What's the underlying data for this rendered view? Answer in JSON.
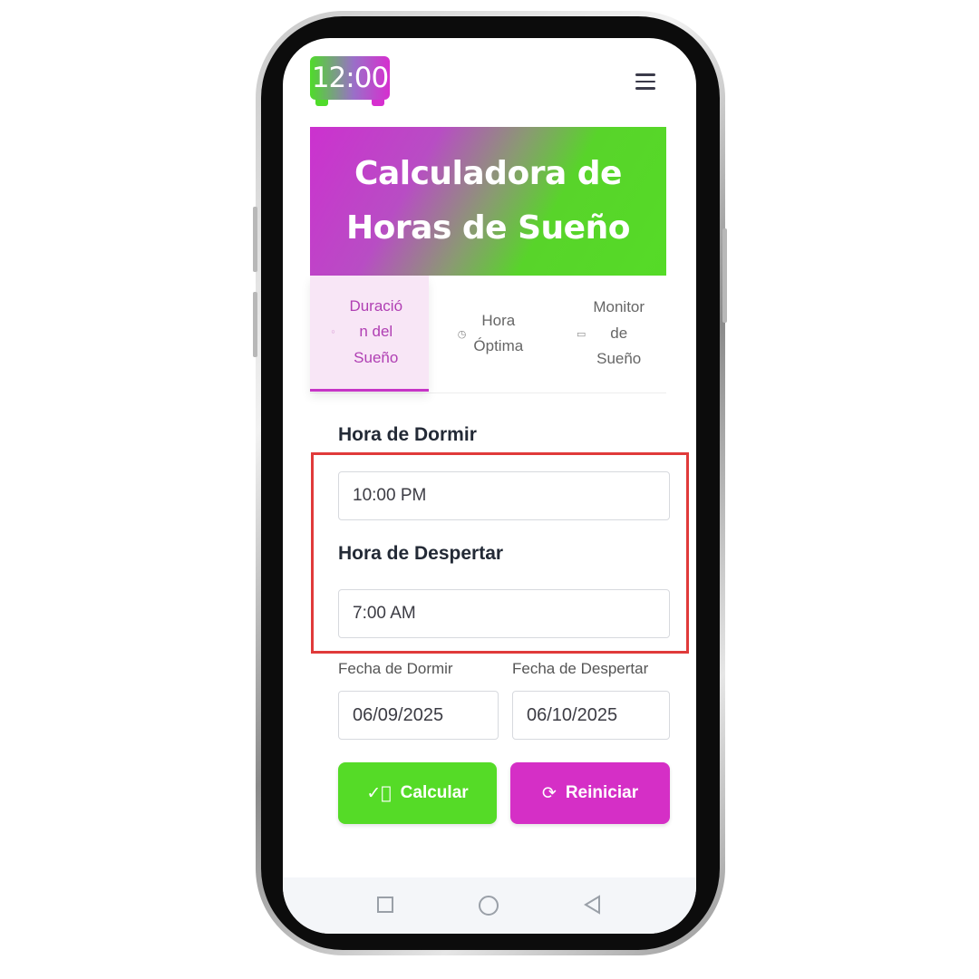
{
  "header": {
    "logo_text": "12:00",
    "menu_icon": "hamburger-menu-icon"
  },
  "banner": {
    "title": "Calculadora de Horas de Sueño"
  },
  "tabs": [
    {
      "label": "Duración del Sueño",
      "display": "Duració\nn del\nSueño",
      "icon": "moon-icon",
      "active": true
    },
    {
      "label": "Hora Óptima",
      "display": "Hora\nÓptima",
      "icon": "clock-icon",
      "active": false
    },
    {
      "label": "Monitor de Sueño",
      "display": "Monitor\nde\nSueño",
      "icon": "calendar-icon",
      "active": false
    }
  ],
  "form": {
    "bedtime_label": "Hora de Dormir",
    "bedtime_value": "10:00 PM",
    "wake_label": "Hora de Despertar",
    "wake_value": "7:00 AM",
    "sleep_date_label": "Fecha de Dormir",
    "sleep_date_value": "06/09/2025",
    "wake_date_label": "Fecha de Despertar",
    "wake_date_value": "06/10/2025"
  },
  "actions": {
    "calculate_label": "Calcular",
    "reset_label": "Reiniciar"
  },
  "colors": {
    "green": "#55db27",
    "magenta": "#d52fc6",
    "highlight": "#e03a3a"
  }
}
